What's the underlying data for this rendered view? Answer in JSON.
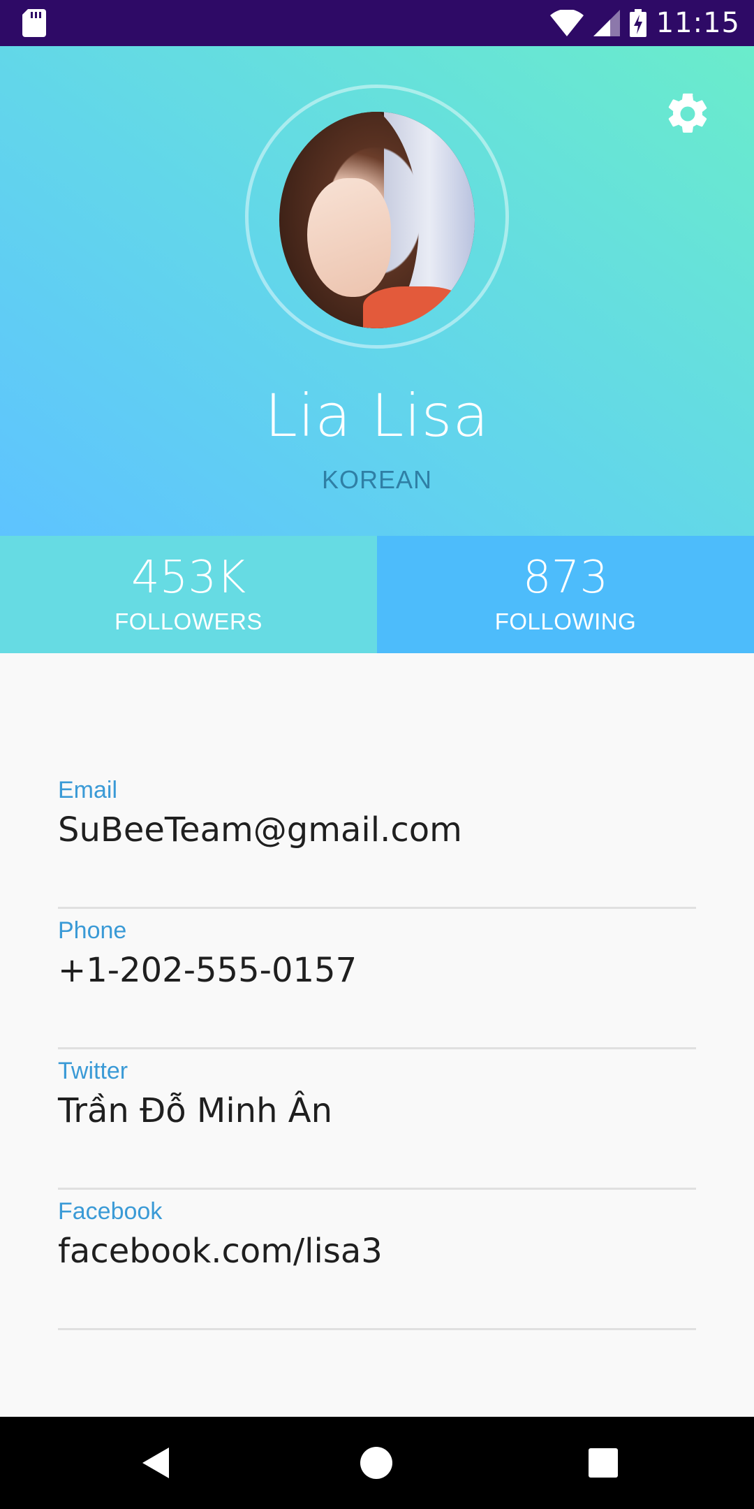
{
  "status_bar": {
    "time": "11:15",
    "icons": [
      "sd-card-icon",
      "wifi-icon",
      "signal-icon",
      "battery-charging-icon"
    ]
  },
  "header": {
    "name": "Lia Lisa",
    "subtitle": "KOREAN",
    "gradient": [
      "#5ec3ff",
      "#62d6ea",
      "#6aeccb"
    ]
  },
  "stats": {
    "followers": {
      "value": "453K",
      "label": "FOLLOWERS"
    },
    "following": {
      "value": "873",
      "label": "FOLLOWING"
    }
  },
  "info": [
    {
      "label": "Email",
      "value": "SuBeeTeam@gmail.com"
    },
    {
      "label": "Phone",
      "value": "+1-202-555-0157"
    },
    {
      "label": "Twitter",
      "value": "Trần Đỗ Minh Ân"
    },
    {
      "label": "Facebook",
      "value": "facebook.com/lisa3"
    }
  ],
  "colors": {
    "status_bar": "#2e0a66",
    "followers_bg": "#66dbe3",
    "following_bg": "#4dbcfb",
    "label_accent": "#3a9ad6"
  },
  "nav": [
    "back-icon",
    "home-icon",
    "recent-apps-icon"
  ]
}
